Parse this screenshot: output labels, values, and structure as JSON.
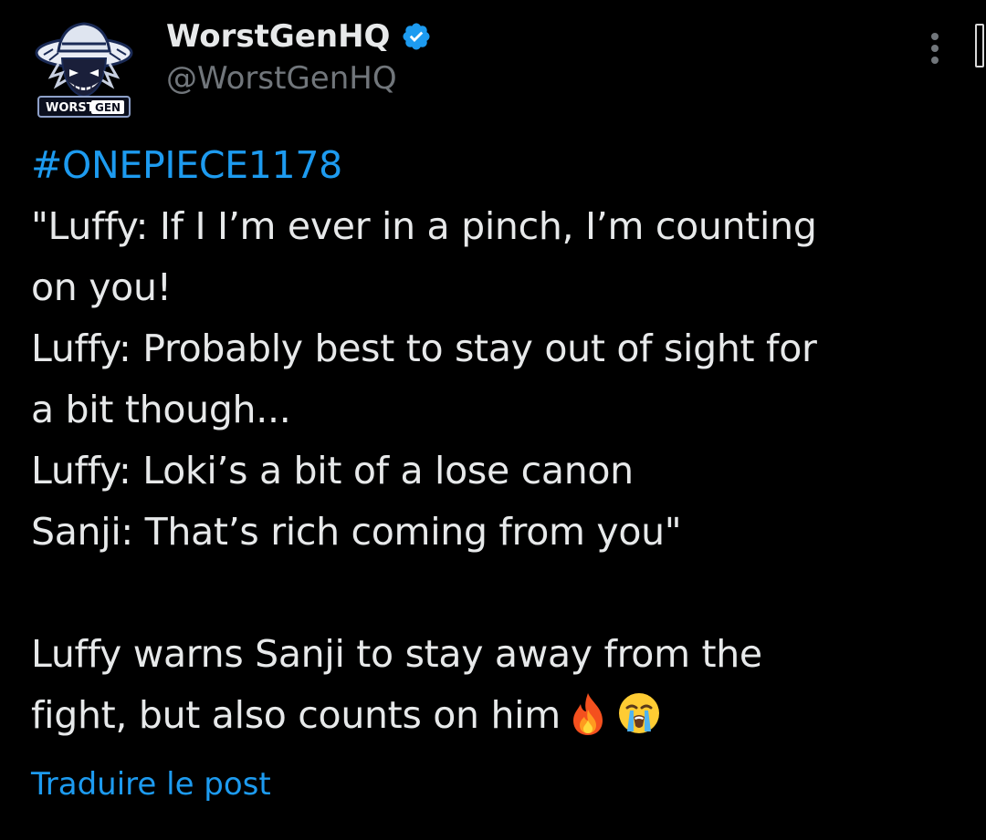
{
  "author": {
    "display_name": "WorstGenHQ",
    "handle": "@WorstGenHQ",
    "verified": true,
    "avatar_logo_text_1": "WORST",
    "avatar_logo_text_2": "GEN"
  },
  "tweet": {
    "hashtag": "#ONEPIECE1178",
    "lines": [
      "\"Luffy: If I I’m ever in a pinch, I’m counting",
      "on you!",
      "Luffy: Probably best to stay out of sight for",
      "a bit though...",
      "Luffy: Loki’s a bit of a lose canon",
      "Sanji: That’s rich coming from you\""
    ],
    "summary_lines": [
      "Luffy warns Sanji to stay away from the",
      "fight, but also counts on him"
    ],
    "emojis": [
      "fire-emoji",
      "loudly-crying-face-emoji"
    ]
  },
  "actions": {
    "translate_label": "Traduire le post",
    "more_icon": "more-vertical-icon"
  },
  "colors": {
    "background": "#000000",
    "text": "#e7e9ea",
    "secondary": "#71767b",
    "accent": "#1d9bf0"
  }
}
